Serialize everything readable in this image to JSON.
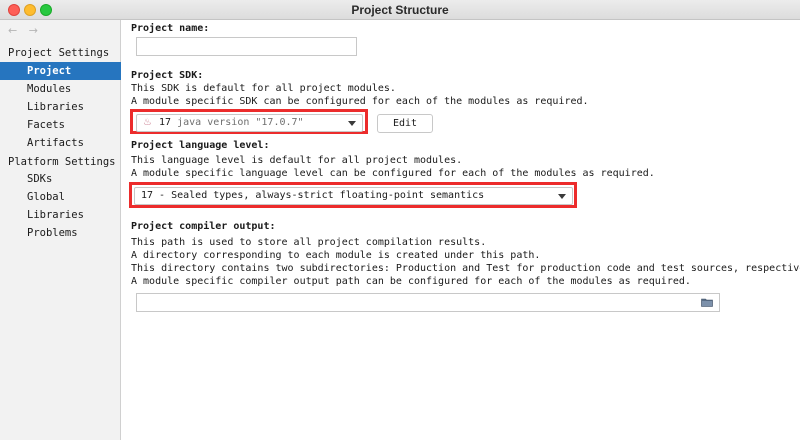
{
  "window": {
    "title": "Project Structure"
  },
  "sidebar": {
    "back_arrow": "←",
    "forward_arrow": "→",
    "project_settings_header": "Project Settings",
    "project_settings_items": [
      "Project",
      "Modules",
      "Libraries",
      "Facets",
      "Artifacts"
    ],
    "platform_settings_header": "Platform Settings",
    "platform_settings_items": [
      "SDKs",
      "Global Libraries"
    ],
    "problems": "Problems",
    "selected_item": "Project"
  },
  "project_name": {
    "label": "Project name:",
    "value": ""
  },
  "project_sdk": {
    "label": "Project SDK:",
    "desc1": "This SDK is default for all project modules.",
    "desc2": "A module specific SDK can be configured for each of the modules as required.",
    "selected_sdk": "17",
    "selected_version": "java version \"17.0.7\"",
    "edit_label": "Edit"
  },
  "language_level": {
    "label": "Project language level:",
    "desc1": "This language level is default for all project modules.",
    "desc2": "A module specific language level can be configured for each of the modules as required.",
    "selected": "17 - Sealed types, always-strict floating-point semantics"
  },
  "compiler_output": {
    "label": "Project compiler output:",
    "desc1": "This path is used to store all project compilation results.",
    "desc2": "A directory corresponding to each module is created under this path.",
    "desc3": "This directory contains two subdirectories: Production and Test for production code and test sources, respectively.",
    "desc4": "A module specific compiler output path can be configured for each of the modules as required.",
    "value": ""
  },
  "colors": {
    "selection": "#2675bf",
    "highlight_box": "#ec2c2c"
  }
}
